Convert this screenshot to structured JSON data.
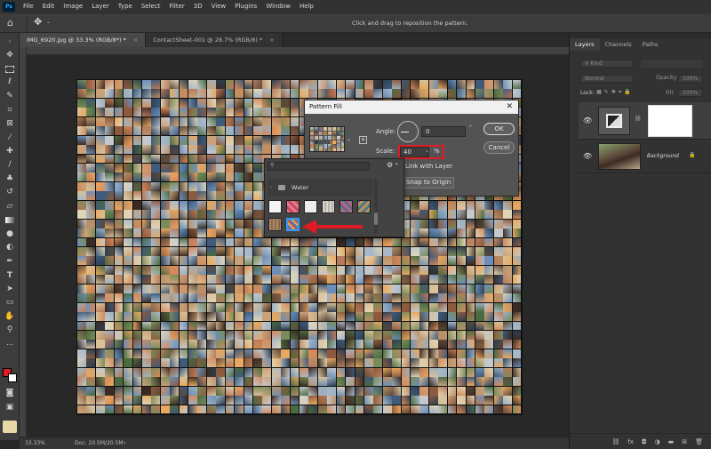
{
  "app": {
    "logo": "Ps"
  },
  "menu": [
    "File",
    "Edit",
    "Image",
    "Layer",
    "Type",
    "Select",
    "Filter",
    "3D",
    "View",
    "Plugins",
    "Window",
    "Help"
  ],
  "options_bar": {
    "hint": "Click and drag to reposition the pattern."
  },
  "tabs": [
    {
      "label": "IMG_6920.jpg @ 33.3% (RGB/8*) *",
      "close": "×",
      "active": true
    },
    {
      "label": "ContactSheet-001 @ 28.7% (RGB/8) *",
      "close": "×",
      "active": false
    }
  ],
  "status": {
    "zoom": "33.33%",
    "doc": "Doc: 20.5M/20.5M",
    "arrow": "›"
  },
  "pattern_fill": {
    "title": "Pattern Fill",
    "close": "✕",
    "angle_label": "Angle:",
    "angle_value": "0",
    "degree": "°",
    "scale_label": "Scale:",
    "scale_value": "40",
    "scale_unit": "%",
    "link_label": "Link with Layer",
    "snap_label": "Snap to Origin",
    "ok": "OK",
    "cancel": "Cancel",
    "highlight_color": "#e01b24"
  },
  "pattern_picker": {
    "folder_name": "Water",
    "search_placeholder": "",
    "selected_border_color": "#2f9bff"
  },
  "annotation": {
    "arrow_color": "#e01b24"
  },
  "layers_panel": {
    "tabs": [
      "Layers",
      "Channels",
      "Paths"
    ],
    "kind": "Kind",
    "blend_mode": "Normal",
    "opacity_label": "Opacity:",
    "opacity_value": "100%",
    "lock_label": "Lock:",
    "fill_label": "Fill:",
    "fill_value": "100%",
    "layers": [
      {
        "name": "",
        "type": "pattern-fill"
      },
      {
        "name": "Background",
        "type": "image",
        "locked": true
      }
    ],
    "footer_icons": [
      "link-icon",
      "fx-icon",
      "mask-icon",
      "adjustment-icon",
      "group-icon",
      "new-layer-icon",
      "trash-icon"
    ]
  },
  "colors": {
    "foreground": "#e01b24",
    "background": "#ffffff"
  }
}
